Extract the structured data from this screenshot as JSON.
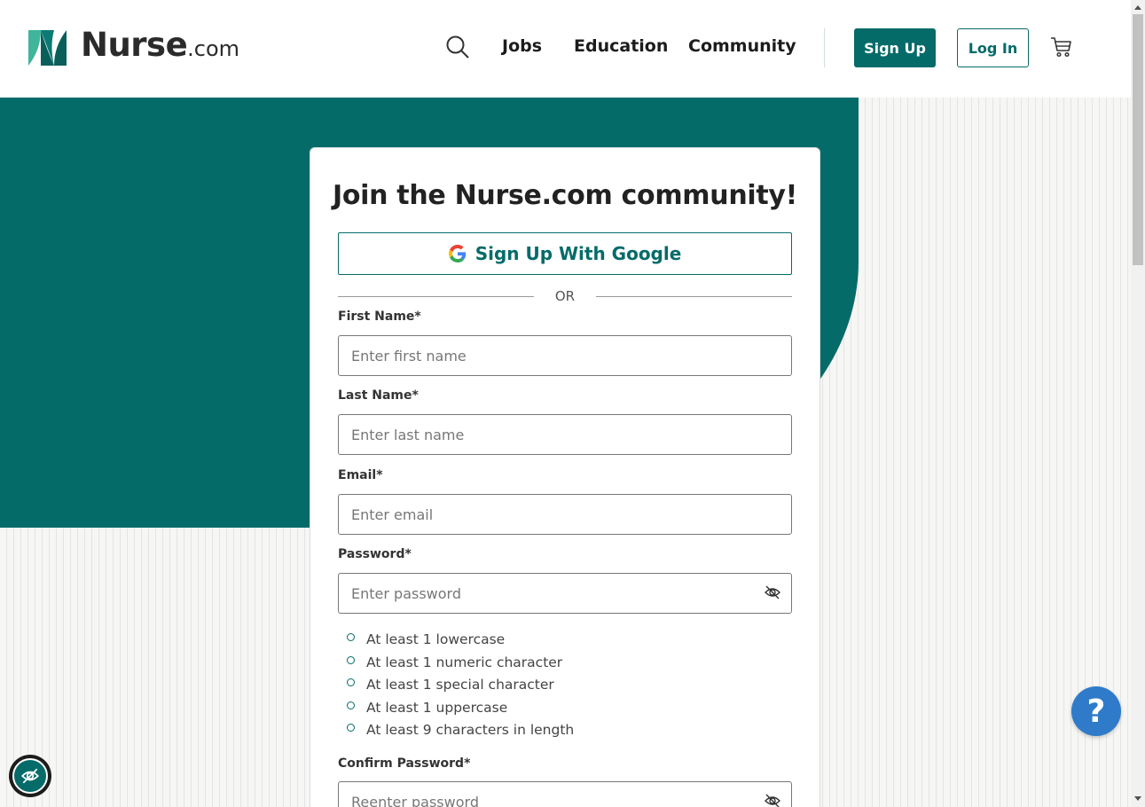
{
  "brand": {
    "name": "Nurse",
    "suffix": ".com",
    "accent_color": "#056b69"
  },
  "header": {
    "search_icon": "search-icon",
    "nav": {
      "jobs": "Jobs",
      "education": "Education",
      "community": "Community"
    },
    "signup_label": "Sign Up",
    "login_label": "Log In",
    "cart_icon": "cart-icon"
  },
  "form": {
    "title": "Join the Nurse.com community!",
    "google_label": "Sign Up With Google",
    "or_label": "OR",
    "first_name": {
      "label": "First Name*",
      "placeholder": "Enter first name"
    },
    "last_name": {
      "label": "Last Name*",
      "placeholder": "Enter last name"
    },
    "email": {
      "label": "Email*",
      "placeholder": "Enter email"
    },
    "password": {
      "label": "Password*",
      "placeholder": "Enter password"
    },
    "password_requirements": [
      "At least 1 lowercase",
      "At least 1 numeric character",
      "At least 1 special character",
      "At least 1 uppercase",
      "At least 9 characters in length"
    ],
    "confirm_password": {
      "label": "Confirm Password*",
      "placeholder": "Reenter password"
    }
  },
  "help": {
    "symbol": "?",
    "color": "#2f7bc9"
  },
  "accessibility": {
    "icon": "eye-slash-icon"
  }
}
